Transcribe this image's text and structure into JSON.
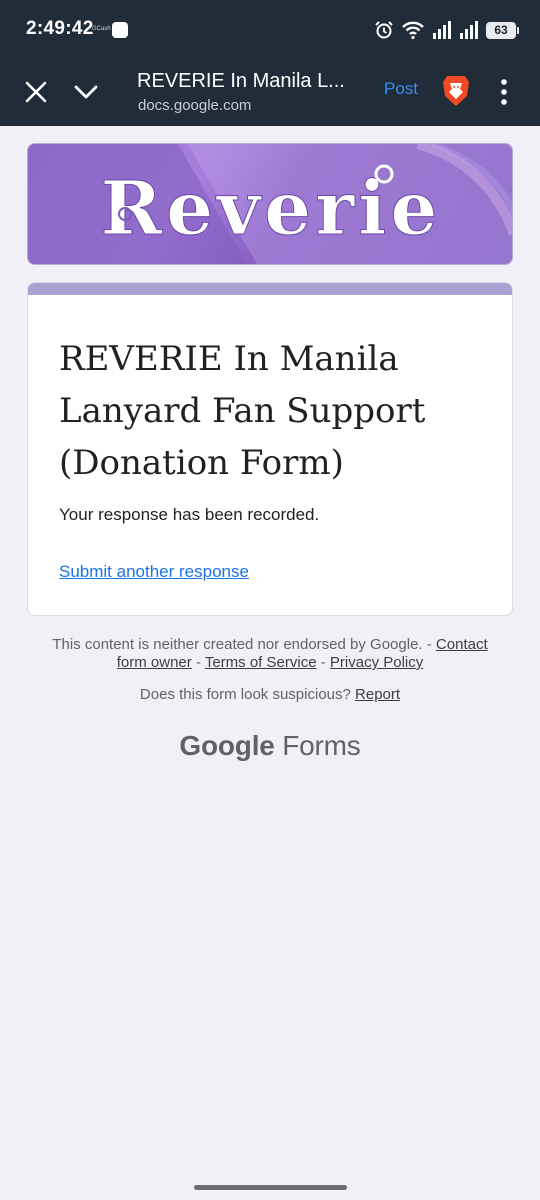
{
  "status_bar": {
    "time": "2:49:42",
    "app_label": "GCash",
    "battery": "63"
  },
  "browser": {
    "page_title": "REVERIE In Manila L...",
    "url": "docs.google.com",
    "post_label": "Post"
  },
  "banner": {
    "logo_text": "Reverie"
  },
  "form": {
    "title": "REVERIE In Manila Lanyard Fan Support (Donation Form)",
    "confirmation": "Your response has been recorded.",
    "submit_another": "Submit another response"
  },
  "footer": {
    "disclaimer": "This content is neither created nor endorsed by Google. -",
    "contact_link": "Contact form owner",
    "sep1": " - ",
    "terms_link": "Terms of Service",
    "sep2": " - ",
    "privacy_link": "Privacy Policy",
    "suspicious_text": "Does this form look suspicious?",
    "report_link": "Report",
    "brand": "Google",
    "product": "Forms"
  },
  "colors": {
    "status_bg": "#202c38",
    "link": "#1a73e8",
    "accent_bar": "#a9a0d3",
    "banner": "#9b78d0"
  }
}
